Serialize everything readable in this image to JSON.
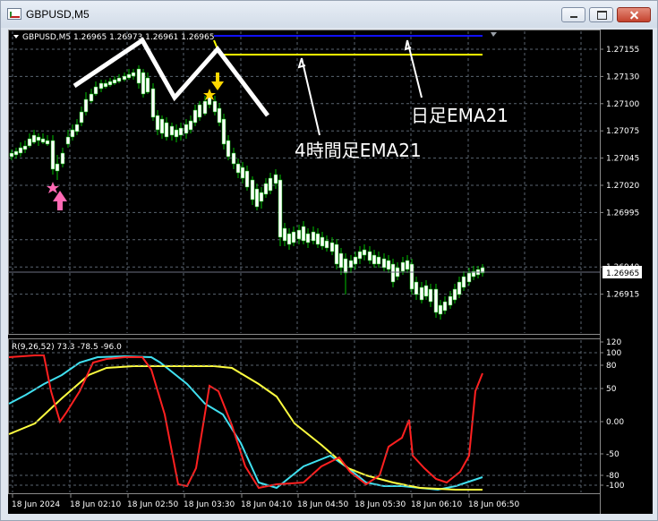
{
  "window": {
    "title": "GBPUSD,M5"
  },
  "main_chart": {
    "info_line": "GBPUSD,M5  1.26965 1.26973 1.26961 1.26965",
    "price_ticks": [
      "1.27155",
      "1.27130",
      "1.27100",
      "1.27075",
      "1.27045",
      "1.27020",
      "1.26995",
      "1.26965",
      "1.26940",
      "1.26915"
    ],
    "current_price": "1.26965",
    "annotation_daily": "日足EMA21",
    "annotation_4h": "4時間足EMA21"
  },
  "indicator": {
    "info_line": "R(9,26,52) 73.3 -78.5 -96.0",
    "level_ticks": [
      "120",
      "100",
      "80",
      "50",
      "0.00",
      "-50",
      "-80",
      "-100"
    ]
  },
  "time_axis": {
    "labels": [
      "18 Jun 2024",
      "18 Jun 02:10",
      "18 Jun 02:50",
      "18 Jun 03:30",
      "18 Jun 04:10",
      "18 Jun 04:50",
      "18 Jun 05:30",
      "18 Jun 06:10",
      "18 Jun 06:50"
    ]
  },
  "colors": {
    "background": "#000000",
    "grid": "#5a6470",
    "bull_candle": "#ffffff",
    "bear_candle": "#ffffff",
    "wick": "#00c000",
    "daily_ema": "#1010ff",
    "h4_ema": "#ffff00",
    "rci_fast": "#ff2020",
    "rci_mid": "#40e0f0",
    "rci_slow": "#ffff40",
    "sell_arrow": "#ffd700",
    "buy_arrow": "#ff69b4"
  }
}
